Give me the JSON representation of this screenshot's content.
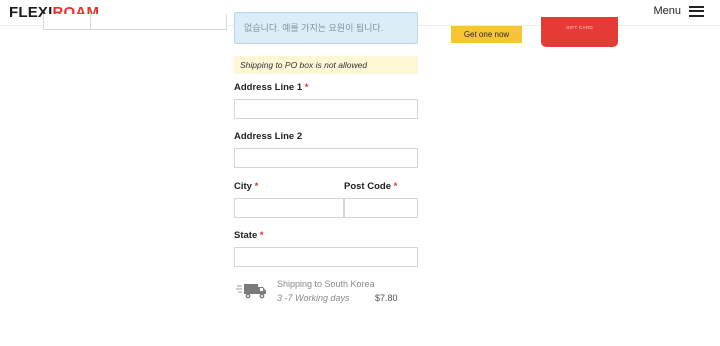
{
  "header": {
    "logo_prefix": "FLEXI",
    "logo_suffix": "ROAM",
    "menu_label": "Menu"
  },
  "info_box": {
    "text": "없습니다. 예를 가지는 요원이 됩니다."
  },
  "notice": {
    "text": "Shipping to PO box is not allowed"
  },
  "form": {
    "address1_label": "Address Line 1",
    "address2_label": "Address Line 2",
    "city_label": "City",
    "postcode_label": "Post Code",
    "state_label": "State",
    "required_mark": "*"
  },
  "shipping": {
    "title": "Shipping to South Korea",
    "days": "3 -7 Working days",
    "price": "$7.80"
  },
  "promo": {
    "button_label": "Get one now",
    "gift_card_label": "GIFT CARD"
  }
}
